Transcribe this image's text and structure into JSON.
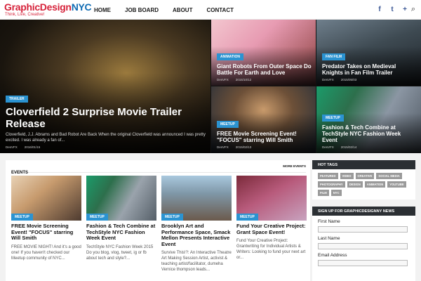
{
  "header": {
    "logo_main": "GraphicDesign",
    "logo_nyc": "NYC",
    "logo_tagline": "Think, Live, Creative!",
    "nav": [
      "HOME",
      "JOB BOARD",
      "ABOUT",
      "CONTACT"
    ],
    "social": {
      "facebook": "f",
      "twitter": "t",
      "plus": "+",
      "search": "⌕"
    }
  },
  "hero": {
    "main": {
      "badge": "TRAILER",
      "title": "Cloverfield 2 Surprise Movie Trailer Release",
      "excerpt": "Cloverfield, J.J. Abrams and Bad Robot Are Back When the original Cloverfield was announced I was pretty excited. I was already a fan of...",
      "author": "DesVFX",
      "date": "2016/01/15"
    },
    "tile2": {
      "badge": "ANIMATION",
      "title": "Giant Robots From Outer Space Do Battle For Earth and Love",
      "author": "DesVFX",
      "date": "2015/10/12"
    },
    "tile3": {
      "badge": "FAN FILM",
      "title": "Predator Takes on Medieval Knights in Fan Film Trailer",
      "author": "DesVFX",
      "date": "2015/05/03"
    },
    "tile4": {
      "badge": "MEETUP",
      "title": "FREE Movie Screening Event! \"FOCUS\" starring Will Smith",
      "author": "DesVFX",
      "date": "2015/02/13"
    },
    "tile5": {
      "badge": "MEETUP",
      "title": "Fashion & Tech Combine at TechStyle NYC Fashion Week Event",
      "author": "DesVFX",
      "date": "2015/02/14"
    }
  },
  "events": {
    "title": "EVENTS",
    "more": "MORE EVENTS",
    "cards": [
      {
        "badge": "MEETUP",
        "title": "FREE Movie Screening Event! \"FOCUS\" starring Will Smith",
        "excerpt": "FREE MOVIE NIGHT! And it's a good one! If you haven't checked our Meetup community of NYC..."
      },
      {
        "badge": "MEETUP",
        "title": "Fashion & Tech Combine at TechStyle NYC Fashion Week Event",
        "excerpt": "TechStyle NYC Fashion Week 2015 Do you blog, vlog, tweet, ig or fb about tech and style?..."
      },
      {
        "badge": "MEETUP",
        "title": "Brooklyn Art and Performance Space, Smack Mellon Presents Interactive Event",
        "excerpt": "Survive This!?: An Interactive Theatre Art Making Session Artist, activist & teaching artist/facilitator, dumeha Vernice thompson leads..."
      },
      {
        "badge": "MEETUP",
        "title": "Fund Your Creative Project: Grant Space Event!",
        "excerpt": "Fund Your Creative Project: Grantwriting for Individual Artists & Writers: Looking to fund your next art or..."
      }
    ]
  },
  "sidebar": {
    "hot_tags_title": "HOT TAGS",
    "tags": [
      "FEATURED",
      "VIDEO",
      "CREATIVE",
      "SOCIAL MEDIA",
      "PHOTOGRAPHY",
      "DESIGN",
      "ANIMATION",
      "YOUTUBE",
      "FILM",
      "NYC"
    ],
    "signup_title": "SIGN UP FOR GRAPHICDESIGNNY NEWS",
    "fields": [
      {
        "label": "First Name"
      },
      {
        "label": "Last Name"
      },
      {
        "label": "Email Address"
      }
    ]
  }
}
